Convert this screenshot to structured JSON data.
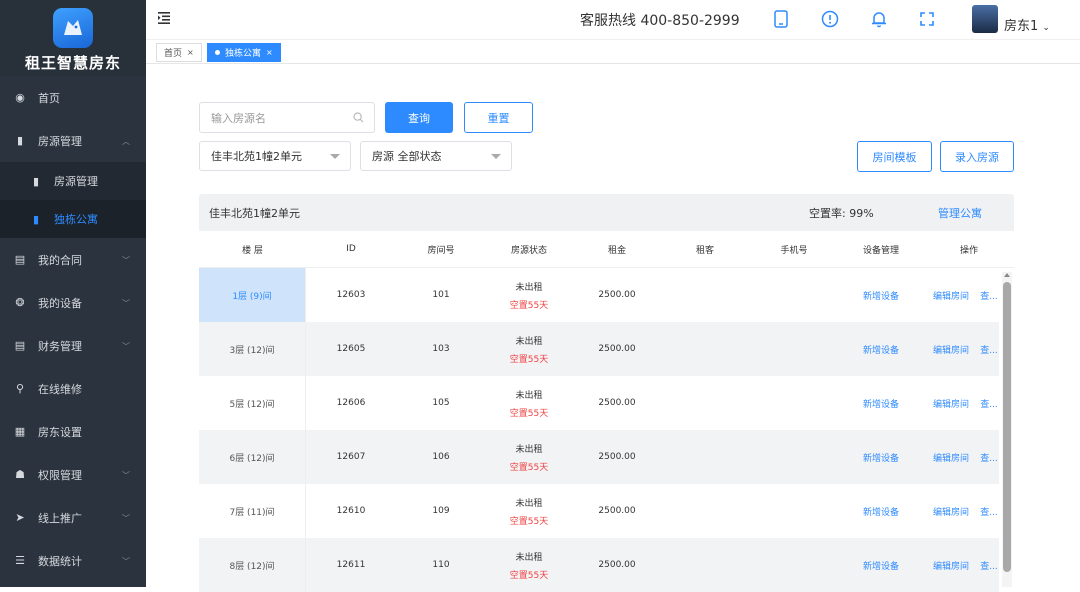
{
  "brand": {
    "name": "租王智慧房东"
  },
  "sidebar": {
    "items": [
      {
        "label": "首页",
        "icon": "globe-icon"
      },
      {
        "label": "房源管理",
        "icon": "building-icon",
        "expanded": true
      },
      {
        "label": "我的合同",
        "icon": "contract-icon"
      },
      {
        "label": "我的设备",
        "icon": "device-icon"
      },
      {
        "label": "财务管理",
        "icon": "finance-icon"
      },
      {
        "label": "在线维修",
        "icon": "search-icon"
      },
      {
        "label": "房东设置",
        "icon": "grid-icon"
      },
      {
        "label": "权限管理",
        "icon": "users-icon"
      },
      {
        "label": "线上推广",
        "icon": "send-icon"
      },
      {
        "label": "数据统计",
        "icon": "list-icon"
      }
    ],
    "sub": [
      {
        "label": "房源管理"
      },
      {
        "label": "独栋公寓",
        "active": true
      }
    ]
  },
  "header": {
    "hotline": "客服热线 400-850-2999",
    "user": "房东1"
  },
  "tabs": [
    {
      "label": "首页"
    },
    {
      "label": "独栋公寓",
      "active": true
    }
  ],
  "filters": {
    "search_placeholder": "输入房源名",
    "query_label": "查询",
    "reset_label": "重置",
    "building_select": "佳丰北苑1幢2单元",
    "status_select": "房源 全部状态",
    "room_template_label": "房间模板",
    "add_room_label": "录入房源"
  },
  "panel": {
    "title": "佳丰北苑1幢2单元",
    "vacancy": "空置率:  99%",
    "manage_label": "管理公寓"
  },
  "table": {
    "headers": [
      "楼 层",
      "ID",
      "房间号",
      "房源状态",
      "租金",
      "租客",
      "手机号",
      "设备管理",
      "操作"
    ],
    "rows": [
      {
        "floor": "1层 (9)间",
        "id": "12603",
        "room": "101",
        "status": "未出租",
        "vacant": "空置55天",
        "rent": "2500.00",
        "device": "新增设备",
        "edit": "编辑房间",
        "view": "查..."
      },
      {
        "floor": "3层 (12)间",
        "id": "12605",
        "room": "103",
        "status": "未出租",
        "vacant": "空置55天",
        "rent": "2500.00",
        "device": "新增设备",
        "edit": "编辑房间",
        "view": "查..."
      },
      {
        "floor": "5层 (12)间",
        "id": "12606",
        "room": "105",
        "status": "未出租",
        "vacant": "空置55天",
        "rent": "2500.00",
        "device": "新增设备",
        "edit": "编辑房间",
        "view": "查..."
      },
      {
        "floor": "6层 (12)间",
        "id": "12607",
        "room": "106",
        "status": "未出租",
        "vacant": "空置55天",
        "rent": "2500.00",
        "device": "新增设备",
        "edit": "编辑房间",
        "view": "查..."
      },
      {
        "floor": "7层 (11)间",
        "id": "12610",
        "room": "109",
        "status": "未出租",
        "vacant": "空置55天",
        "rent": "2500.00",
        "device": "新增设备",
        "edit": "编辑房间",
        "view": "查..."
      },
      {
        "floor": "8层 (12)间",
        "id": "12611",
        "room": "110",
        "status": "未出租",
        "vacant": "空置55天",
        "rent": "2500.00",
        "device": "新增设备",
        "edit": "编辑房间",
        "view": "查..."
      }
    ]
  },
  "colors": {
    "accent": "#2e8bff",
    "sidebar_bg": "#2b333e",
    "vacant_red": "#f04040"
  }
}
